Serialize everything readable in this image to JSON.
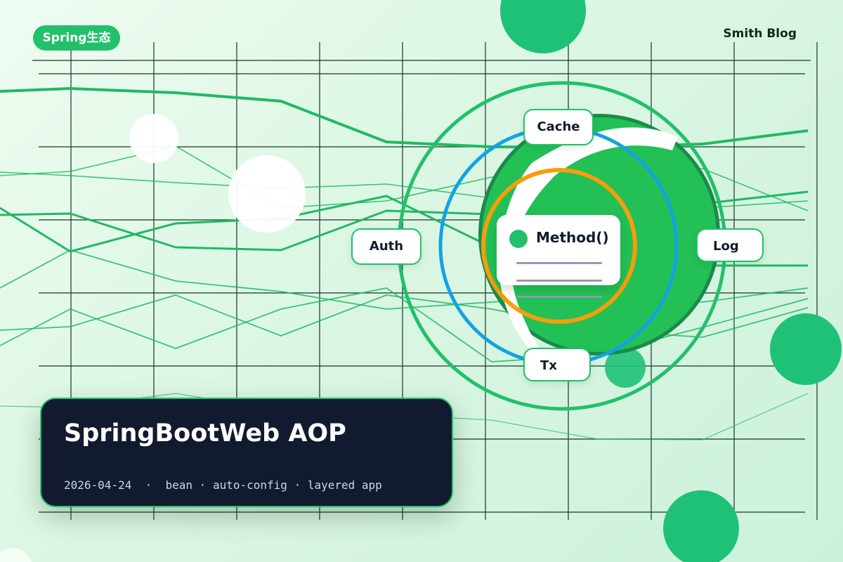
{
  "badge": {
    "label": "Spring生态"
  },
  "brand": {
    "label": "Smith Blog"
  },
  "aspects": {
    "cache": "Cache",
    "auth": "Auth",
    "log": "Log",
    "tx": "Tx"
  },
  "method": {
    "label": "Method()"
  },
  "card": {
    "title": "SpringBootWeb AOP",
    "date": "2026-04-24",
    "separator": "·",
    "tags": [
      "bean",
      "auto-config",
      "layered app"
    ]
  },
  "colors": {
    "accent_green": "#22c06a",
    "ring_blue": "#12a3e3",
    "ring_orange": "#f59e0b",
    "card_dark": "#111a2e"
  }
}
